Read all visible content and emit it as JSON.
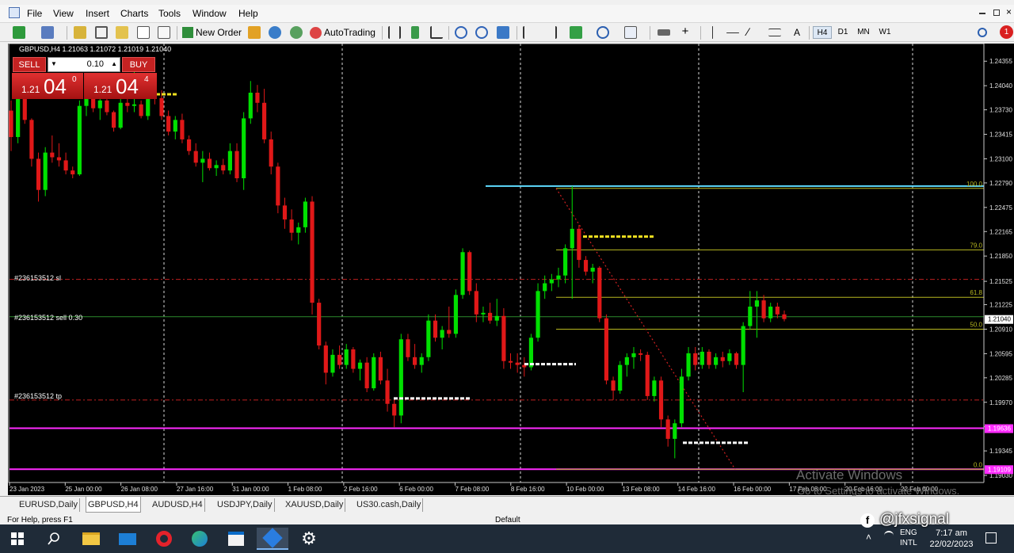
{
  "menu": {
    "items": [
      "File",
      "View",
      "Insert",
      "Charts",
      "Tools",
      "Window",
      "Help"
    ]
  },
  "toolbar": {
    "new_order_label": "New Order",
    "autotrading_label": "AutoTrading",
    "timeframes": [
      "H4",
      "D1",
      "MN",
      "W1"
    ],
    "notification_count": "1"
  },
  "chart": {
    "info_line": "GBPUSD,H4  1.21063 1.21072 1.21019 1.21040",
    "sell_label": "SELL",
    "buy_label": "BUY",
    "lot": "0.10",
    "sell_price_small": "1.21",
    "sell_price_big": "04",
    "sell_price_sup": "0",
    "buy_price_small": "1.21",
    "buy_price_big": "04",
    "buy_price_sup": "4",
    "order_sl_label": "#236153512 sl",
    "order_sell_label": "#236153512 sell 0.30",
    "order_tp_label": "#236153512 tp",
    "current_price_tag": "1.21040",
    "pink_line_tag_1": "1.19636",
    "pink_line_tag_2": "1.19109",
    "watermark_title": "Activate Windows",
    "watermark_sub": "Go to Settings to activate Windows.",
    "social_handle": "@jfxsignal"
  },
  "fib_levels": [
    {
      "label": "100.0",
      "price": 1.2272
    },
    {
      "label": "79.0",
      "price": 1.2193
    },
    {
      "label": "61.8",
      "price": 1.2132
    },
    {
      "label": "50.0",
      "price": 1.2091
    },
    {
      "label": "0.0",
      "price": 1.19109
    }
  ],
  "chart_data": {
    "type": "candlestick",
    "symbol": "GBPUSD",
    "timeframe": "H4",
    "ylim": [
      1.19,
      1.245
    ],
    "y_ticks": [
      "1.24355",
      "1.24040",
      "1.23730",
      "1.23415",
      "1.23100",
      "1.22790",
      "1.22475",
      "1.22165",
      "1.21850",
      "1.21525",
      "1.21225",
      "1.20910",
      "1.20595",
      "1.20285",
      "1.19970",
      "1.19655",
      "1.19345",
      "1.19030"
    ],
    "x_ticks": [
      "23 Jan 2023",
      "25 Jan 00:00",
      "26 Jan 08:00",
      "27 Jan 16:00",
      "31 Jan 00:00",
      "1 Feb 08:00",
      "2 Feb 16:00",
      "6 Feb 00:00",
      "7 Feb 08:00",
      "8 Feb 16:00",
      "10 Feb 00:00",
      "13 Feb 08:00",
      "14 Feb 16:00",
      "16 Feb 00:00",
      "17 Feb 08:00",
      "20 Feb 16:00",
      "22 Feb 00:00"
    ],
    "horizontal_lines": [
      {
        "name": "sl",
        "price": 1.2155
      },
      {
        "name": "entry",
        "price": 1.2107
      },
      {
        "name": "tp",
        "price": 1.2
      },
      {
        "name": "pink-1",
        "price": 1.19636
      },
      {
        "name": "pink-2",
        "price": 1.19109
      },
      {
        "name": "cyan-high",
        "price": 1.2275
      }
    ],
    "candles": [
      [
        1.2372,
        1.2385,
        1.232,
        1.2338
      ],
      [
        1.2338,
        1.2395,
        1.233,
        1.2388
      ],
      [
        1.2388,
        1.2396,
        1.2355,
        1.236
      ],
      [
        1.236,
        1.2362,
        1.23,
        1.231
      ],
      [
        1.231,
        1.2318,
        1.2255,
        1.227
      ],
      [
        1.227,
        1.2325,
        1.2262,
        1.2318
      ],
      [
        1.2318,
        1.234,
        1.2305,
        1.2312
      ],
      [
        1.2312,
        1.233,
        1.23,
        1.2308
      ],
      [
        1.2308,
        1.2318,
        1.229,
        1.2295
      ],
      [
        1.2295,
        1.23,
        1.2285,
        1.229
      ],
      [
        1.229,
        1.2385,
        1.2288,
        1.2378
      ],
      [
        1.2378,
        1.24,
        1.2365,
        1.239
      ],
      [
        1.239,
        1.2392,
        1.237,
        1.2375
      ],
      [
        1.2375,
        1.2388,
        1.236,
        1.2385
      ],
      [
        1.2385,
        1.2395,
        1.2366,
        1.237
      ],
      [
        1.237,
        1.2372,
        1.2345,
        1.235
      ],
      [
        1.235,
        1.239,
        1.2348,
        1.2382
      ],
      [
        1.2382,
        1.2396,
        1.237,
        1.2378
      ],
      [
        1.2378,
        1.243,
        1.237,
        1.238
      ],
      [
        1.238,
        1.2385,
        1.2362,
        1.2365
      ],
      [
        1.2365,
        1.2395,
        1.236,
        1.239
      ],
      [
        1.239,
        1.24,
        1.238,
        1.2388
      ],
      [
        1.2388,
        1.2398,
        1.236,
        1.2365
      ],
      [
        1.2365,
        1.2372,
        1.234,
        1.2345
      ],
      [
        1.2345,
        1.2365,
        1.2335,
        1.236
      ],
      [
        1.236,
        1.2368,
        1.233,
        1.2335
      ],
      [
        1.2335,
        1.234,
        1.2315,
        1.232
      ],
      [
        1.232,
        1.233,
        1.23,
        1.2305
      ],
      [
        1.2305,
        1.232,
        1.228,
        1.231
      ],
      [
        1.231,
        1.2318,
        1.2295,
        1.2298
      ],
      [
        1.2298,
        1.2308,
        1.2288,
        1.2302
      ],
      [
        1.2302,
        1.231,
        1.229,
        1.2295
      ],
      [
        1.2295,
        1.233,
        1.229,
        1.232
      ],
      [
        1.232,
        1.233,
        1.228,
        1.2285
      ],
      [
        1.2285,
        1.237,
        1.227,
        1.2362
      ],
      [
        1.2362,
        1.241,
        1.2355,
        1.2395
      ],
      [
        1.2395,
        1.2405,
        1.237,
        1.2382
      ],
      [
        1.2382,
        1.24,
        1.233,
        1.2335
      ],
      [
        1.2335,
        1.2345,
        1.229,
        1.23
      ],
      [
        1.23,
        1.2305,
        1.224,
        1.225
      ],
      [
        1.225,
        1.226,
        1.222,
        1.2232
      ],
      [
        1.2232,
        1.2245,
        1.2205,
        1.2215
      ],
      [
        1.2215,
        1.2228,
        1.22,
        1.2222
      ],
      [
        1.2222,
        1.226,
        1.2215,
        1.2255
      ],
      [
        1.2255,
        1.2262,
        1.211,
        1.2125
      ],
      [
        1.2125,
        1.213,
        1.2065,
        1.207
      ],
      [
        1.207,
        1.2075,
        1.202,
        1.2035
      ],
      [
        1.2035,
        1.2065,
        1.203,
        1.2058
      ],
      [
        1.2058,
        1.207,
        1.204,
        1.2045
      ],
      [
        1.2045,
        1.2072,
        1.204,
        1.2065
      ],
      [
        1.2065,
        1.2068,
        1.2035,
        1.204
      ],
      [
        1.204,
        1.2052,
        1.2025,
        1.2048
      ],
      [
        1.2048,
        1.2055,
        1.201,
        1.2015
      ],
      [
        1.2015,
        1.206,
        1.2012,
        1.2055
      ],
      [
        1.2055,
        1.2062,
        1.202,
        1.2025
      ],
      [
        1.2025,
        1.204,
        1.1985,
        1.1995
      ],
      [
        1.1995,
        1.2,
        1.1965,
        1.198
      ],
      [
        1.198,
        1.2085,
        1.197,
        1.2078
      ],
      [
        1.2078,
        1.2085,
        1.205,
        1.2055
      ],
      [
        1.2055,
        1.2072,
        1.204,
        1.2045
      ],
      [
        1.2045,
        1.206,
        1.2035,
        1.2055
      ],
      [
        1.2055,
        1.211,
        1.205,
        1.2102
      ],
      [
        1.2102,
        1.211,
        1.2075,
        1.208
      ],
      [
        1.208,
        1.2095,
        1.2065,
        1.209
      ],
      [
        1.209,
        1.212,
        1.208,
        1.2085
      ],
      [
        1.2085,
        1.2142,
        1.208,
        1.2135
      ],
      [
        1.2135,
        1.2195,
        1.213,
        1.219
      ],
      [
        1.219,
        1.2192,
        1.2135,
        1.214
      ],
      [
        1.214,
        1.215,
        1.21,
        1.211
      ],
      [
        1.211,
        1.212,
        1.21,
        1.2112
      ],
      [
        1.2112,
        1.2125,
        1.2098,
        1.2102
      ],
      [
        1.2102,
        1.213,
        1.2095,
        1.2108
      ],
      [
        1.2108,
        1.2118,
        1.204,
        1.205
      ],
      [
        1.205,
        1.206,
        1.204,
        1.2048
      ],
      [
        1.2048,
        1.206,
        1.2035,
        1.2045
      ],
      [
        1.2045,
        1.2055,
        1.203,
        1.2042
      ],
      [
        1.2042,
        1.2085,
        1.2038,
        1.208
      ],
      [
        1.208,
        1.215,
        1.2075,
        1.214
      ],
      [
        1.214,
        1.216,
        1.213,
        1.215
      ],
      [
        1.215,
        1.2162,
        1.214,
        1.2155
      ],
      [
        1.2155,
        1.217,
        1.2145,
        1.216
      ],
      [
        1.216,
        1.22,
        1.215,
        1.2195
      ],
      [
        1.2195,
        1.2275,
        1.213,
        1.222
      ],
      [
        1.222,
        1.2225,
        1.217,
        1.218
      ],
      [
        1.218,
        1.2185,
        1.216,
        1.2165
      ],
      [
        1.2165,
        1.2175,
        1.215,
        1.217
      ],
      [
        1.217,
        1.2172,
        1.21,
        1.2105
      ],
      [
        1.2105,
        1.211,
        1.202,
        1.2025
      ],
      [
        1.2025,
        1.203,
        1.2,
        1.2012
      ],
      [
        1.2012,
        1.205,
        1.2008,
        1.2045
      ],
      [
        1.2045,
        1.206,
        1.203,
        1.2055
      ],
      [
        1.2055,
        1.2068,
        1.204,
        1.206
      ],
      [
        1.206,
        1.2065,
        1.205,
        1.2058
      ],
      [
        1.2058,
        1.2062,
        1.2,
        1.2005
      ],
      [
        1.2005,
        1.203,
        1.1998,
        1.2025
      ],
      [
        1.2025,
        1.203,
        1.1965,
        1.1975
      ],
      [
        1.1975,
        1.198,
        1.194,
        1.195
      ],
      [
        1.195,
        1.1975,
        1.1925,
        1.197
      ],
      [
        1.197,
        1.204,
        1.1965,
        1.203
      ],
      [
        1.203,
        1.2068,
        1.2025,
        1.206
      ],
      [
        1.206,
        1.2068,
        1.2038,
        1.2045
      ],
      [
        1.2045,
        1.2068,
        1.204,
        1.2062
      ],
      [
        1.2062,
        1.2065,
        1.204,
        1.2045
      ],
      [
        1.2045,
        1.206,
        1.204,
        1.2055
      ],
      [
        1.2055,
        1.2062,
        1.2042,
        1.205
      ],
      [
        1.205,
        1.2065,
        1.2045,
        1.206
      ],
      [
        1.206,
        1.2062,
        1.204,
        1.2045
      ],
      [
        1.2045,
        1.21,
        1.201,
        1.2095
      ],
      [
        1.2095,
        1.214,
        1.209,
        1.212
      ],
      [
        1.212,
        1.214,
        1.208,
        1.2128
      ],
      [
        1.2128,
        1.2135,
        1.21,
        1.2105
      ],
      [
        1.2105,
        1.2125,
        1.21,
        1.212
      ],
      [
        1.212,
        1.2125,
        1.2105,
        1.211
      ],
      [
        1.211,
        1.2115,
        1.2101,
        1.2104
      ]
    ]
  },
  "tabs": [
    "EURUSD,Daily",
    "GBPUSD,H4",
    "AUDUSD,H4",
    "USDJPY,Daily",
    "XAUUSD,Daily",
    "US30.cash,Daily"
  ],
  "status": {
    "left": "For Help, press F1",
    "profile": "Default"
  },
  "taskbar": {
    "lang_top": "ENG",
    "lang_bottom": "INTL",
    "time": "7:17 am",
    "date": "22/02/2023"
  },
  "colors": {
    "bull": "#00e000",
    "bear": "#e01818",
    "fib": "#b8b820",
    "pink": "#ff2bff",
    "cyan": "#5fdcff",
    "sl_tp": "#c02020"
  }
}
